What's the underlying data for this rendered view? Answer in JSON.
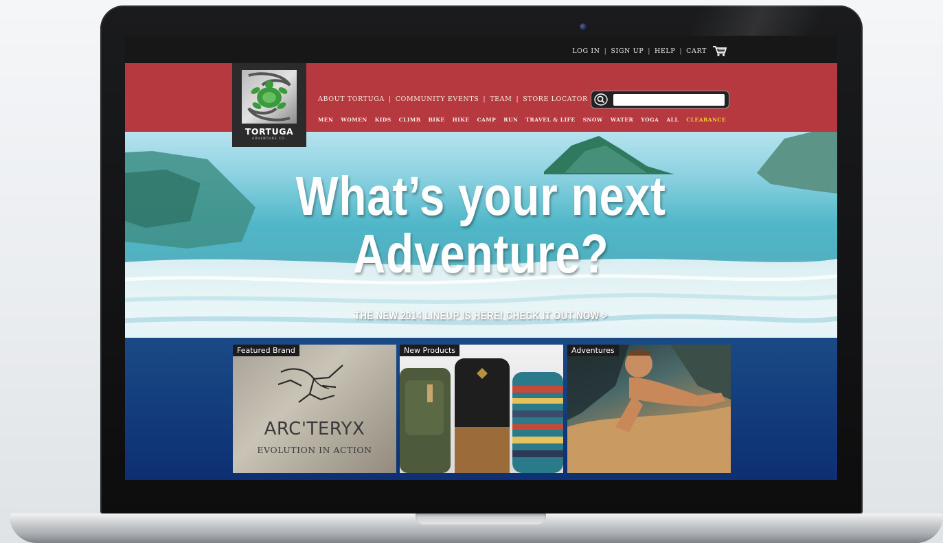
{
  "utility_nav": {
    "items": [
      "LOG IN",
      "SIGN UP",
      "HELP",
      "CART"
    ],
    "cart_icon": "shopping-cart-icon"
  },
  "logo": {
    "name": "TORTUGA",
    "subtitle": "ADVENTURE CO.",
    "icon": "turtle-logo-icon"
  },
  "secondary_nav": {
    "items": [
      "ABOUT TORTUGA",
      "COMMUNITY EVENTS",
      "TEAM",
      "STORE LOCATOR"
    ]
  },
  "search": {
    "placeholder": "",
    "value": "",
    "icon": "search-icon"
  },
  "category_nav": {
    "items": [
      "MEN",
      "WOMEN",
      "KIDS",
      "CLIMB",
      "BIKE",
      "HIKE",
      "CAMP",
      "RUN",
      "TRAVEL & LIFE",
      "SNOW",
      "WATER",
      "YOGA",
      "ALL"
    ],
    "highlight": "CLEARANCE",
    "highlight_color": "#f5d030"
  },
  "hero": {
    "title_line1": "What’s your next",
    "title_line2": "Adventure?",
    "cta": "THE NEW 2014 LINEUP IS HERE! CHECK IT OUT NOW >"
  },
  "tiles": {
    "featured_label": "Featured Brand",
    "brand_name": "ARC'TERYX",
    "brand_tagline": "EVOLUTION IN ACTION",
    "new_label": "New Products",
    "adventures_label": "Adventures"
  },
  "colors": {
    "header_red": "#b5393f",
    "topbar_black": "#171718",
    "content_blue": "#0d2f73"
  }
}
